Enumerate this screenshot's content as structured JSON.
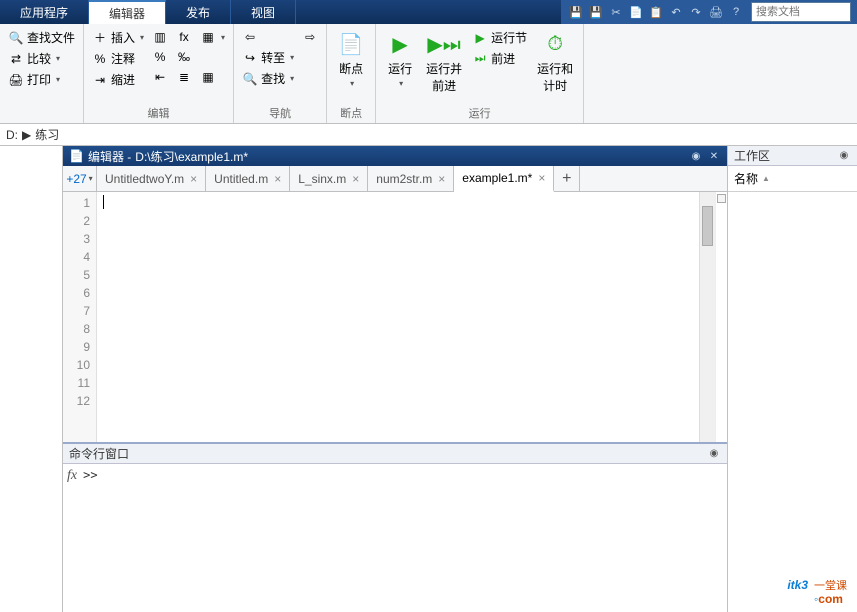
{
  "menu": {
    "tabs": [
      "应用程序",
      "编辑器",
      "发布",
      "视图"
    ],
    "active_index": 1,
    "search_placeholder": "搜索文档"
  },
  "quick_icons": [
    "save-icon",
    "save-all-icon",
    "cut-icon",
    "copy-icon",
    "paste-icon",
    "undo-icon",
    "redo-icon",
    "print-icon",
    "help-icon"
  ],
  "ribbon": {
    "groups": [
      {
        "label": "",
        "left_col": [
          {
            "icon": "🔍",
            "text": "查找文件",
            "name": "find-file"
          },
          {
            "icon": "⇄",
            "text": "比较",
            "dd": true,
            "name": "compare"
          },
          {
            "icon": "🖨",
            "text": "打印",
            "dd": true,
            "name": "print"
          }
        ]
      },
      {
        "label": "编辑",
        "cols": [
          [
            {
              "icon": "＋",
              "text": "插入",
              "dd": true,
              "name": "insert"
            },
            {
              "icon": "%",
              "text": "注释",
              "name": "comment"
            },
            {
              "icon": "⇥",
              "text": "缩进",
              "name": "indent"
            }
          ],
          [
            {
              "icon": "▥",
              "name": "insert-section"
            },
            {
              "icon": "%",
              "name": "comment-toggle"
            },
            {
              "icon": "⇤",
              "name": "outdent"
            }
          ],
          [
            {
              "icon": "fx",
              "name": "fx"
            },
            {
              "icon": "‰",
              "name": "uncomment"
            },
            {
              "icon": "≣",
              "name": "smart-indent"
            }
          ],
          [
            {
              "icon": "▦",
              "dd": true,
              "name": "code-fold"
            },
            {
              "icon": "",
              "name": "spacer"
            },
            {
              "icon": "▦",
              "name": "format"
            }
          ]
        ]
      },
      {
        "label": "导航",
        "cols": [
          [
            {
              "icon": "⇦",
              "name": "back"
            },
            {
              "icon": "↪",
              "text": "转至",
              "dd": true,
              "name": "goto"
            },
            {
              "icon": "🔍",
              "text": "查找",
              "dd": true,
              "name": "find"
            }
          ],
          [
            {
              "icon": "⇨",
              "name": "fwd"
            }
          ]
        ]
      },
      {
        "label": "断点",
        "big": {
          "icon": "📄",
          "text": "断点",
          "dd": true,
          "name": "breakpoints",
          "color": "#d22"
        }
      },
      {
        "label": "运行",
        "items": [
          {
            "icon": "▶",
            "text": "运行",
            "dd": true,
            "name": "run",
            "color": "#2a2"
          },
          {
            "icon": "▶⏭",
            "text": "运行并\n前进",
            "name": "run-advance",
            "color": "#2a2"
          },
          {
            "side": [
              {
                "icon": "▶",
                "text": "运行节",
                "name": "run-section",
                "color": "#2a2"
              },
              {
                "icon": "⏭",
                "text": "前进",
                "name": "advance",
                "color": "#2a2"
              }
            ]
          },
          {
            "icon": "⏱",
            "text": "运行和\n计时",
            "name": "run-time",
            "color": "#2a2"
          }
        ]
      }
    ]
  },
  "breadcrumb": {
    "sep": "▶",
    "items": [
      "D:",
      "练习"
    ]
  },
  "editor": {
    "title_prefix": "编辑器 - ",
    "path": "D:\\练习\\example1.m*",
    "overflow": "+27",
    "tabs": [
      {
        "label": "UntitledtwoY.m"
      },
      {
        "label": "Untitled.m"
      },
      {
        "label": "L_sinx.m"
      },
      {
        "label": "num2str.m"
      },
      {
        "label": "example1.m*",
        "active": true
      }
    ],
    "line_count": 12
  },
  "command_window": {
    "title": "命令行窗口",
    "fx": "fx",
    "prompt": ">>"
  },
  "workspace": {
    "title": "工作区",
    "col": "名称"
  },
  "watermark": {
    "brand": "itk3",
    "sub1": "一堂课",
    "dot": "◦",
    "com": "com"
  }
}
